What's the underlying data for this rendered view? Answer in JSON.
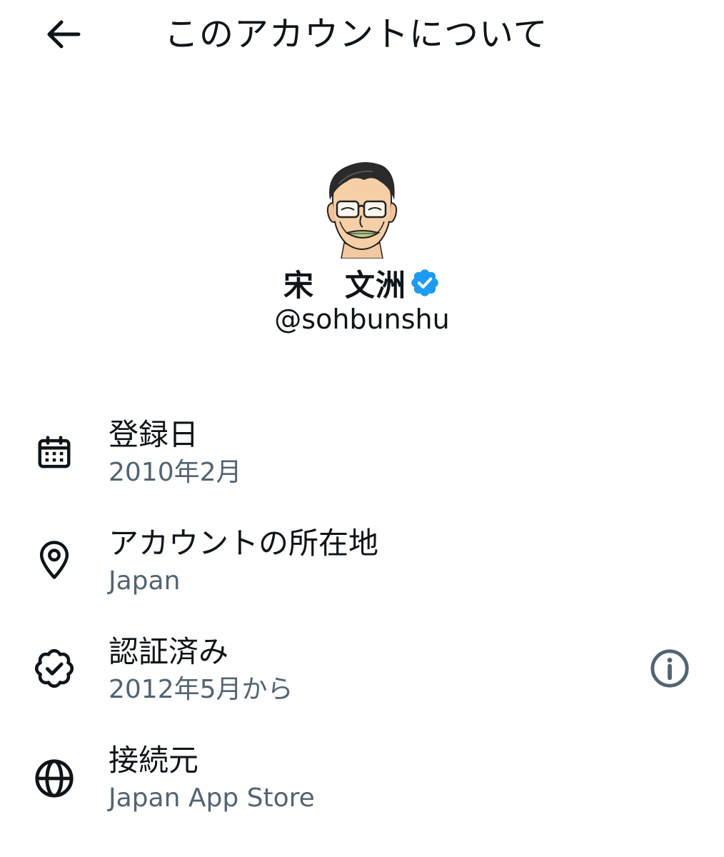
{
  "header": {
    "back_icon": "arrow-left-icon",
    "title": "このアカウントについて"
  },
  "profile": {
    "display_name": "宋　文洲",
    "verified_icon": "verified-badge-icon",
    "handle": "@sohbunshu"
  },
  "rows": [
    {
      "icon": "calendar-icon",
      "label": "登録日",
      "value": "2010年2月"
    },
    {
      "icon": "location-pin-icon",
      "label": "アカウントの所在地",
      "value": "Japan"
    },
    {
      "icon": "verified-check-icon",
      "label": "認証済み",
      "value": "2012年5月から",
      "action_icon": "info-icon"
    },
    {
      "icon": "globe-icon",
      "label": "接続元",
      "value": "Japan App Store"
    }
  ],
  "colors": {
    "primary_text": "#0f1419",
    "secondary_text": "#536471",
    "verified_blue": "#1d9bf0",
    "background": "#ffffff"
  }
}
